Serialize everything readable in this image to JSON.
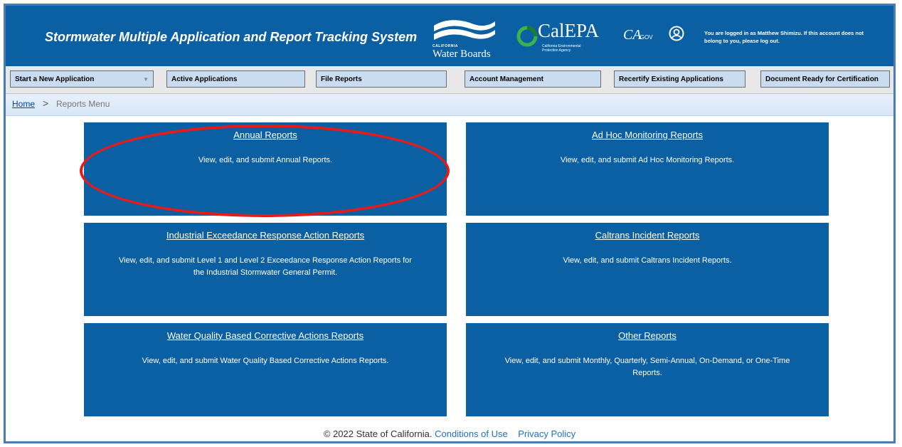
{
  "header": {
    "app_title": "Stormwater Multiple Application and Report Tracking System",
    "logos": {
      "water_boards_small": "CALIFORNIA",
      "water_boards": "Water Boards",
      "calepa": "CalEPA",
      "calepa_sub": "California Environmental Protection Agency",
      "cagov": "CA",
      "cagov_suffix": ".GOV"
    },
    "login_message": "You are logged in as Matthew Shimizu. If this account does not belong to you, please log out."
  },
  "navbar": {
    "items": [
      {
        "label": "Start a New Application",
        "has_dropdown": true
      },
      {
        "label": "Active Applications"
      },
      {
        "label": "File Reports"
      },
      {
        "label": "Account Management"
      },
      {
        "label": "Recertify Existing Applications"
      },
      {
        "label": "Document Ready for Certification"
      }
    ]
  },
  "breadcrumb": {
    "home": "Home",
    "separator": ">",
    "current": "Reports Menu"
  },
  "tiles": [
    {
      "title": "Annual Reports",
      "description": "View, edit, and submit Annual Reports."
    },
    {
      "title": "Ad Hoc Monitoring Reports",
      "description": "View, edit, and submit Ad Hoc Monitoring Reports."
    },
    {
      "title": "Industrial Exceedance Response Action Reports",
      "description": "View, edit, and submit Level 1 and Level 2 Exceedance Response Action Reports for the Industrial Stormwater General Permit."
    },
    {
      "title": "Caltrans Incident Reports",
      "description": "View, edit, and submit Caltrans Incident Reports."
    },
    {
      "title": "Water Quality Based Corrective Actions Reports",
      "description": "View, edit, and submit Water Quality Based Corrective Actions Reports."
    },
    {
      "title": "Other Reports",
      "description": "View, edit, and submit Monthly, Quarterly, Semi-Annual, On-Demand, or One-Time Reports."
    }
  ],
  "footer": {
    "copyright": "© 2022 State of California.",
    "conditions": "Conditions of Use",
    "privacy": "Privacy Policy"
  },
  "colors": {
    "brand_blue": "#0b5fa3",
    "nav_button": "#c9dcf0",
    "annotation_red": "#e31b1b",
    "link": "#1f6fd0"
  }
}
